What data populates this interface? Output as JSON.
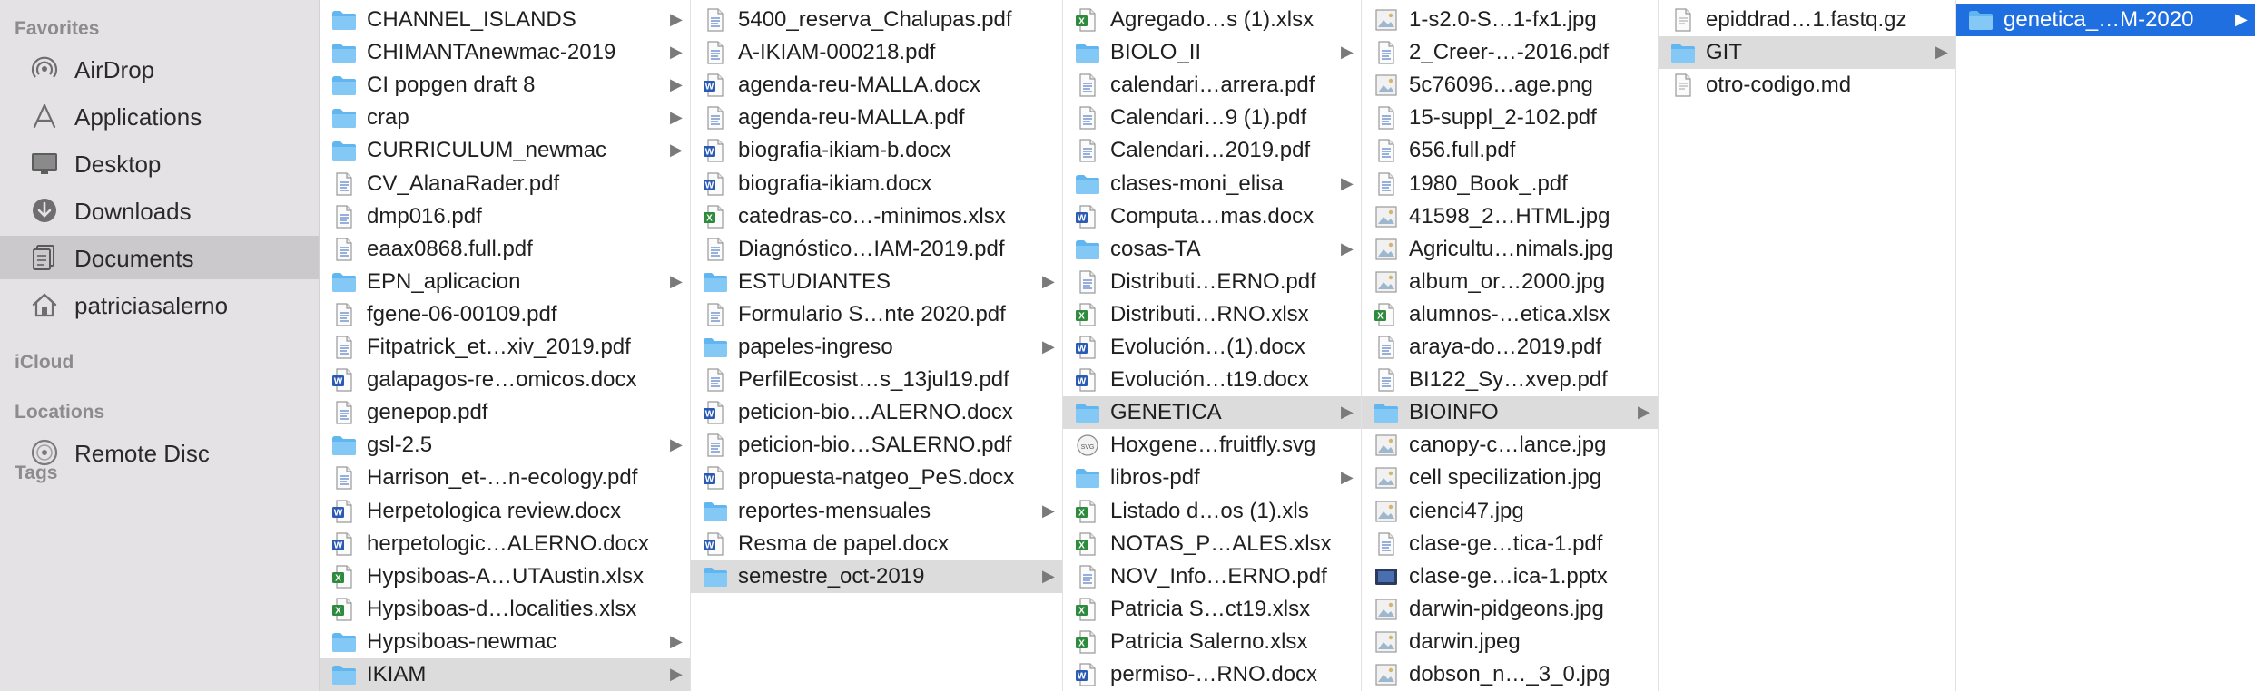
{
  "sidebar": {
    "sections": [
      {
        "label": "Favorites",
        "items": [
          {
            "label": "AirDrop",
            "icon": "airdrop-icon"
          },
          {
            "label": "Applications",
            "icon": "applications-icon"
          },
          {
            "label": "Desktop",
            "icon": "desktop-icon"
          },
          {
            "label": "Downloads",
            "icon": "downloads-icon"
          },
          {
            "label": "Documents",
            "icon": "documents-icon",
            "selected": true
          },
          {
            "label": "patriciasalerno",
            "icon": "home-icon"
          }
        ]
      },
      {
        "label": "iCloud",
        "items": []
      },
      {
        "label": "Locations",
        "items": [
          {
            "label": "Remote Disc",
            "icon": "remote-disc-icon"
          }
        ]
      },
      {
        "label": "Tags",
        "items": []
      }
    ]
  },
  "columns": [
    {
      "items": [
        {
          "name": "CHANNEL_ISLANDS",
          "type": "folder",
          "arrow": true
        },
        {
          "name": "CHIMANTAnewmac-2019",
          "type": "folder",
          "arrow": true
        },
        {
          "name": "CI popgen draft 8",
          "type": "folder",
          "arrow": true
        },
        {
          "name": "crap",
          "type": "folder",
          "arrow": true
        },
        {
          "name": "CURRICULUM_newmac",
          "type": "folder",
          "arrow": true
        },
        {
          "name": "CV_AlanaRader.pdf",
          "type": "pdf"
        },
        {
          "name": "dmp016.pdf",
          "type": "pdf"
        },
        {
          "name": "eaax0868.full.pdf",
          "type": "pdf"
        },
        {
          "name": "EPN_aplicacion",
          "type": "folder",
          "arrow": true
        },
        {
          "name": "fgene-06-00109.pdf",
          "type": "pdf"
        },
        {
          "name": "Fitpatrick_et…xiv_2019.pdf",
          "type": "pdf"
        },
        {
          "name": "galapagos-re…omicos.docx",
          "type": "docx"
        },
        {
          "name": "genepop.pdf",
          "type": "pdf"
        },
        {
          "name": "gsl-2.5",
          "type": "folder",
          "arrow": true
        },
        {
          "name": "Harrison_et-…n-ecology.pdf",
          "type": "pdf"
        },
        {
          "name": "Herpetologica review.docx",
          "type": "docx"
        },
        {
          "name": "herpetologic…ALERNO.docx",
          "type": "docx"
        },
        {
          "name": "Hypsiboas-A…UTAustin.xlsx",
          "type": "xlsx"
        },
        {
          "name": "Hypsiboas-d…localities.xlsx",
          "type": "xlsx"
        },
        {
          "name": "Hypsiboas-newmac",
          "type": "folder",
          "arrow": true
        },
        {
          "name": "IKIAM",
          "type": "folder",
          "arrow": true,
          "selected": true
        }
      ]
    },
    {
      "items": [
        {
          "name": "5400_reserva_Chalupas.pdf",
          "type": "pdf"
        },
        {
          "name": "A-IKIAM-000218.pdf",
          "type": "pdf"
        },
        {
          "name": "agenda-reu-MALLA.docx",
          "type": "docx"
        },
        {
          "name": "agenda-reu-MALLA.pdf",
          "type": "pdf"
        },
        {
          "name": "biografia-ikiam-b.docx",
          "type": "docx"
        },
        {
          "name": "biografia-ikiam.docx",
          "type": "docx"
        },
        {
          "name": "catedras-co…-minimos.xlsx",
          "type": "xlsx"
        },
        {
          "name": "Diagnóstico…IAM-2019.pdf",
          "type": "pdf"
        },
        {
          "name": "ESTUDIANTES",
          "type": "folder",
          "arrow": true
        },
        {
          "name": "Formulario S…nte 2020.pdf",
          "type": "pdf"
        },
        {
          "name": "papeles-ingreso",
          "type": "folder",
          "arrow": true
        },
        {
          "name": "PerfilEcosist…s_13jul19.pdf",
          "type": "pdf"
        },
        {
          "name": "peticion-bio…ALERNO.docx",
          "type": "docx"
        },
        {
          "name": "peticion-bio…SALERNO.pdf",
          "type": "pdf"
        },
        {
          "name": "propuesta-natgeo_PeS.docx",
          "type": "docx"
        },
        {
          "name": "reportes-mensuales",
          "type": "folder",
          "arrow": true
        },
        {
          "name": "Resma de papel.docx",
          "type": "docx"
        },
        {
          "name": "semestre_oct-2019",
          "type": "folder",
          "arrow": true,
          "selected": true
        }
      ]
    },
    {
      "items": [
        {
          "name": "Agregado…s (1).xlsx",
          "type": "xlsx"
        },
        {
          "name": "BIOLO_II",
          "type": "folder",
          "arrow": true
        },
        {
          "name": "calendari…arrera.pdf",
          "type": "pdf"
        },
        {
          "name": "Calendari…9 (1).pdf",
          "type": "pdf"
        },
        {
          "name": "Calendari…2019.pdf",
          "type": "pdf"
        },
        {
          "name": "clases-moni_elisa",
          "type": "folder",
          "arrow": true
        },
        {
          "name": "Computa…mas.docx",
          "type": "docx"
        },
        {
          "name": "cosas-TA",
          "type": "folder",
          "arrow": true
        },
        {
          "name": "Distributi…ERNO.pdf",
          "type": "pdf"
        },
        {
          "name": "Distributi…RNO.xlsx",
          "type": "xlsx"
        },
        {
          "name": "Evolución…(1).docx",
          "type": "docx"
        },
        {
          "name": "Evolución…t19.docx",
          "type": "docx"
        },
        {
          "name": "GENETICA",
          "type": "folder",
          "arrow": true,
          "selected": true
        },
        {
          "name": "Hoxgene…fruitfly.svg",
          "type": "svg"
        },
        {
          "name": "libros-pdf",
          "type": "folder",
          "arrow": true
        },
        {
          "name": "Listado d…os (1).xls",
          "type": "xlsx"
        },
        {
          "name": "NOTAS_P…ALES.xlsx",
          "type": "xlsx"
        },
        {
          "name": "NOV_Info…ERNO.pdf",
          "type": "pdf"
        },
        {
          "name": "Patricia S…ct19.xlsx",
          "type": "xlsx"
        },
        {
          "name": "Patricia Salerno.xlsx",
          "type": "xlsx"
        },
        {
          "name": "permiso-…RNO.docx",
          "type": "docx"
        }
      ]
    },
    {
      "items": [
        {
          "name": "1-s2.0-S…1-fx1.jpg",
          "type": "image"
        },
        {
          "name": "2_Creer-…-2016.pdf",
          "type": "pdf"
        },
        {
          "name": "5c76096…age.png",
          "type": "image"
        },
        {
          "name": "15-suppl_2-102.pdf",
          "type": "pdf"
        },
        {
          "name": "656.full.pdf",
          "type": "pdf"
        },
        {
          "name": "1980_Book_.pdf",
          "type": "pdf"
        },
        {
          "name": "41598_2…HTML.jpg",
          "type": "image"
        },
        {
          "name": "Agricultu…nimals.jpg",
          "type": "image"
        },
        {
          "name": "album_or…2000.jpg",
          "type": "image"
        },
        {
          "name": "alumnos-…etica.xlsx",
          "type": "xlsx"
        },
        {
          "name": "araya-do…2019.pdf",
          "type": "pdf"
        },
        {
          "name": "BI122_Sy…xvep.pdf",
          "type": "pdf"
        },
        {
          "name": "BIOINFO",
          "type": "folder",
          "arrow": true,
          "selected": true
        },
        {
          "name": "canopy-c…lance.jpg",
          "type": "image"
        },
        {
          "name": "cell specilization.jpg",
          "type": "image"
        },
        {
          "name": "cienci47.jpg",
          "type": "image"
        },
        {
          "name": "clase-ge…tica-1.pdf",
          "type": "pdf"
        },
        {
          "name": "clase-ge…ica-1.pptx",
          "type": "pptx"
        },
        {
          "name": "darwin-pidgeons.jpg",
          "type": "image"
        },
        {
          "name": "darwin.jpeg",
          "type": "image"
        },
        {
          "name": "dobson_n…_3_0.jpg",
          "type": "image"
        }
      ]
    },
    {
      "items": [
        {
          "name": "epiddrad…1.fastq.gz",
          "type": "file"
        },
        {
          "name": "GIT",
          "type": "folder",
          "arrow": true,
          "selected": true
        },
        {
          "name": "otro-codigo.md",
          "type": "file"
        }
      ]
    },
    {
      "items": [
        {
          "name": "genetica_…M-2020",
          "type": "folder",
          "arrow": true,
          "active": true
        }
      ]
    }
  ],
  "colors": {
    "sidebar_bg": "#e4e2e4",
    "sidebar_selected": "#cbc9cb",
    "row_selected": "#dcdcdc",
    "row_active": "#1f6fe0",
    "folder": "#62b6ef",
    "word": "#2b5ab3",
    "excel": "#2e8b3e"
  }
}
